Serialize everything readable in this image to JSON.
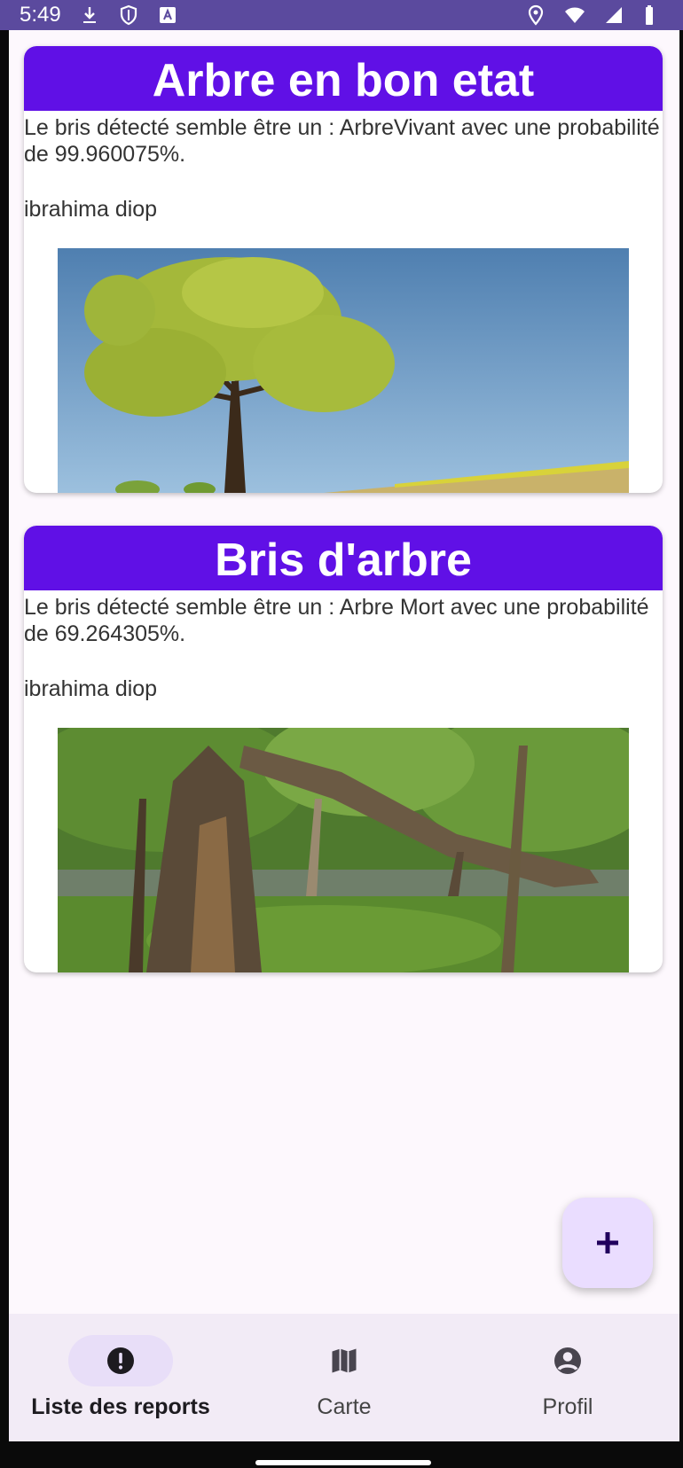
{
  "status_bar": {
    "time": "5:49",
    "left_icons": [
      "download-icon",
      "shield-icon",
      "a-square-icon"
    ],
    "right_icons": [
      "location-pin-icon",
      "wifi-icon",
      "signal-icon",
      "battery-icon"
    ]
  },
  "reports": [
    {
      "title": "Arbre en bon etat",
      "description": "Le bris détecté semble être un : ArbreVivant avec une probabilité de 99.960075%.",
      "author": "ibrahima diop",
      "image": "healthy-tree-photo"
    },
    {
      "title": "Bris d'arbre",
      "description": "Le bris détecté semble être un : Arbre Mort avec une probabilité de 69.264305%.",
      "author": "ibrahima diop",
      "image": "broken-tree-photo"
    }
  ],
  "fab": {
    "icon": "plus-icon"
  },
  "bottom_nav": {
    "items": [
      {
        "label": "Liste des reports",
        "icon": "alert-circle-icon",
        "active": true
      },
      {
        "label": "Carte",
        "icon": "map-icon",
        "active": false
      },
      {
        "label": "Profil",
        "icon": "account-circle-icon",
        "active": false
      }
    ]
  },
  "colors": {
    "status_bar": "#5b4a9e",
    "card_header": "#6010e6",
    "fab_bg": "#eaddff",
    "active_pill": "#e8def8",
    "nav_bg": "#f2ebf6",
    "screen_bg": "#fdf8fd"
  }
}
